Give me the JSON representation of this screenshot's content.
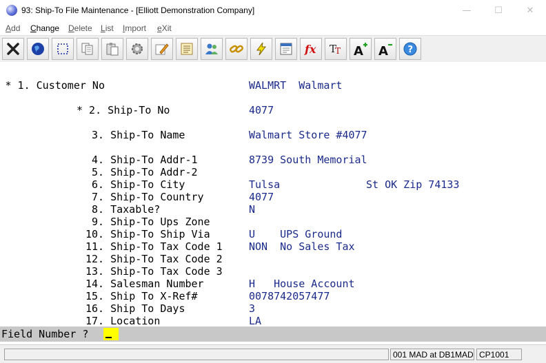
{
  "window": {
    "title": "93: Ship-To File Maintenance - [Elliott Demonstration Company]",
    "minimize": "—",
    "maximize": "☐",
    "close": "✕"
  },
  "menu": [
    {
      "first": "A",
      "rest": "dd"
    },
    {
      "first": "C",
      "rest": "hange"
    },
    {
      "first": "D",
      "rest": "elete"
    },
    {
      "first": "L",
      "rest": "ist"
    },
    {
      "first": "I",
      "rest": "mport"
    },
    {
      "first": "e",
      "rest": "Xit"
    }
  ],
  "toolbar_icons": [
    "close-icon",
    "globe-icon",
    "select-icon",
    "copy-icon",
    "paste-icon",
    "settings-icon",
    "edit-icon",
    "notes-icon",
    "users-icon",
    "link-icon",
    "lightning-icon",
    "report-icon",
    "function-icon",
    "font-icon",
    "font-larger-icon",
    "font-smaller-icon",
    "help-icon"
  ],
  "fields": {
    "customer_no": {
      "label": "* 1. Customer No",
      "value": "WALMRT  Walmart"
    },
    "ship_to_no": {
      "label": "* 2. Ship-To No",
      "value": "4077"
    },
    "ship_to_name": {
      "label": "3. Ship-To Name",
      "value": "Walmart Store #4077"
    },
    "addr1": {
      "label": "4. Ship-To Addr-1",
      "value": "8739 South Memorial"
    },
    "addr2": {
      "label": "5. Ship-To Addr-2",
      "value": ""
    },
    "city": {
      "label": "6. Ship-To City",
      "value": "Tulsa",
      "state_zip": "St OK Zip 74133"
    },
    "country": {
      "label": "7. Ship-To Country",
      "value": "4077"
    },
    "taxable": {
      "label": "8. Taxable?",
      "value": "N"
    },
    "ups_zone": {
      "label": "9. Ship-To Ups Zone",
      "value": ""
    },
    "ship_via": {
      "label": "10. Ship-To Ship Via",
      "value": "U    UPS Ground"
    },
    "tax_code1": {
      "label": "11. Ship-To Tax Code 1",
      "value": "NON  No Sales Tax"
    },
    "tax_code2": {
      "label": "12. Ship-To Tax Code 2",
      "value": ""
    },
    "tax_code3": {
      "label": "13. Ship-To Tax Code 3",
      "value": ""
    },
    "salesman": {
      "label": "14. Salesman Number",
      "value": "H   House Account"
    },
    "xref": {
      "label": "15. Ship To X-Ref#",
      "value": "0078742057477"
    },
    "days": {
      "label": "16. Ship To Days",
      "value": "3"
    },
    "location": {
      "label": "17. Location",
      "value": "LA"
    }
  },
  "prompt": {
    "label": "Field Number ?"
  },
  "status": {
    "company": "001 MAD at DB1MAD",
    "code": "CP1001"
  }
}
